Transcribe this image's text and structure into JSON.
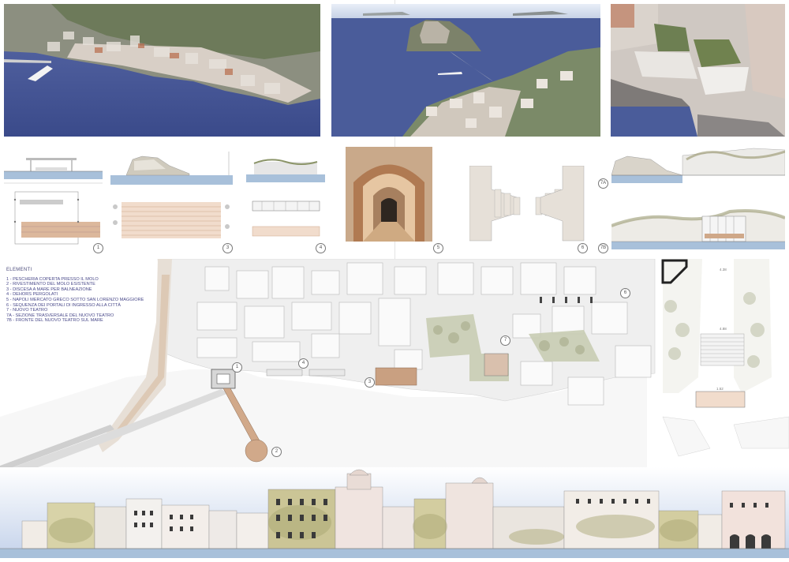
{
  "legend": {
    "heading": "ELEMENTI",
    "items": [
      "1  - PESCHERIA COPERTA PRESSO IL MOLO",
      "2  - RIVESTIMENTO DEL MOLO ESISTENTE",
      "3  - DISCESA A MARE PER BALNEAZIONE",
      "4  - DEHORS PERGOLATI",
      "5  - NAPOLI MERCATO GRECO SOTTO SAN LORENZO  MAGGIORE",
      "6  - SEQUENZA DEI PORTALI DI INGRESSO ALLA CITTÀ",
      "7  - NUOVO TEATRO",
      "7A - SEZIONE TRASVERSALE DEL NUOVO TEATRO",
      "7B - FRONTE DEL NUOVO TEATRO SUL MARE"
    ]
  },
  "drawing_tags": {
    "d1": "1",
    "d3": "3",
    "d4": "4",
    "d5": "5",
    "d6": "6",
    "d7a": "7A",
    "d7b": "7B"
  },
  "plan_tags": [
    "1",
    "2",
    "3",
    "4",
    "7",
    "6"
  ],
  "theatre_dims": {
    "top": "4.38",
    "middle": "4.88",
    "bottom": "1.52"
  },
  "colors": {
    "sea": "#4a5fa0",
    "sky": "#c9d5e9",
    "plan_fill": "#efefef",
    "greenery": "#9aa07a",
    "wood": "#cfa889",
    "water_strip": "#a8c0da"
  }
}
